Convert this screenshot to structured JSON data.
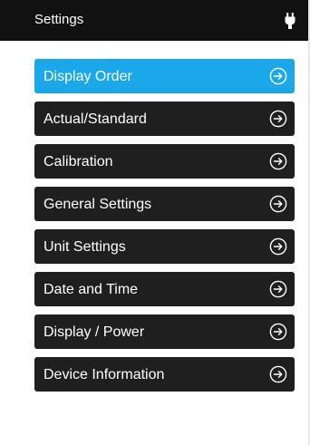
{
  "header": {
    "title": "Settings",
    "power_icon": "plug-icon"
  },
  "colors": {
    "header_bg": "#111111",
    "item_bg": "#1f1f1f",
    "active_bg": "#1ba8ea",
    "text": "#ffffff"
  },
  "menu": {
    "items": [
      {
        "label": "Display Order",
        "active": true,
        "icon": "arrow-right-circle-icon"
      },
      {
        "label": "Actual/Standard",
        "active": false,
        "icon": "arrow-right-circle-icon"
      },
      {
        "label": "Calibration",
        "active": false,
        "icon": "arrow-right-circle-icon"
      },
      {
        "label": "General Settings",
        "active": false,
        "icon": "arrow-right-circle-icon"
      },
      {
        "label": "Unit Settings",
        "active": false,
        "icon": "arrow-right-circle-icon"
      },
      {
        "label": "Date and Time",
        "active": false,
        "icon": "arrow-right-circle-icon"
      },
      {
        "label": "Display / Power",
        "active": false,
        "icon": "arrow-right-circle-icon"
      },
      {
        "label": "Device Information",
        "active": false,
        "icon": "arrow-right-circle-icon"
      }
    ]
  }
}
